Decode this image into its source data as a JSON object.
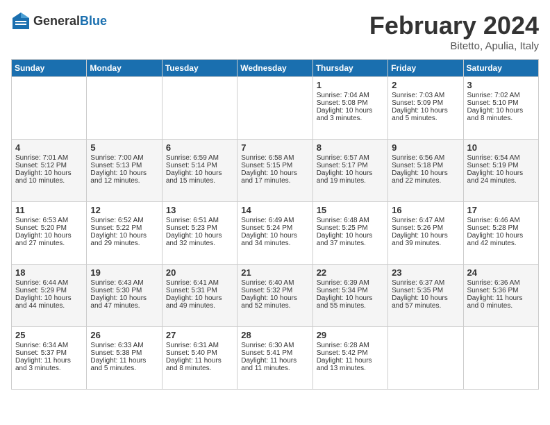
{
  "header": {
    "logo_general": "General",
    "logo_blue": "Blue",
    "title": "February 2024",
    "subtitle": "Bitetto, Apulia, Italy"
  },
  "days_of_week": [
    "Sunday",
    "Monday",
    "Tuesday",
    "Wednesday",
    "Thursday",
    "Friday",
    "Saturday"
  ],
  "weeks": [
    [
      {
        "day": "",
        "sunrise": "",
        "sunset": "",
        "daylight": "",
        "empty": true
      },
      {
        "day": "",
        "sunrise": "",
        "sunset": "",
        "daylight": "",
        "empty": true
      },
      {
        "day": "",
        "sunrise": "",
        "sunset": "",
        "daylight": "",
        "empty": true
      },
      {
        "day": "",
        "sunrise": "",
        "sunset": "",
        "daylight": "",
        "empty": true
      },
      {
        "day": "1",
        "sunrise": "Sunrise: 7:04 AM",
        "sunset": "Sunset: 5:08 PM",
        "daylight": "Daylight: 10 hours and 3 minutes."
      },
      {
        "day": "2",
        "sunrise": "Sunrise: 7:03 AM",
        "sunset": "Sunset: 5:09 PM",
        "daylight": "Daylight: 10 hours and 5 minutes."
      },
      {
        "day": "3",
        "sunrise": "Sunrise: 7:02 AM",
        "sunset": "Sunset: 5:10 PM",
        "daylight": "Daylight: 10 hours and 8 minutes."
      }
    ],
    [
      {
        "day": "4",
        "sunrise": "Sunrise: 7:01 AM",
        "sunset": "Sunset: 5:12 PM",
        "daylight": "Daylight: 10 hours and 10 minutes."
      },
      {
        "day": "5",
        "sunrise": "Sunrise: 7:00 AM",
        "sunset": "Sunset: 5:13 PM",
        "daylight": "Daylight: 10 hours and 12 minutes."
      },
      {
        "day": "6",
        "sunrise": "Sunrise: 6:59 AM",
        "sunset": "Sunset: 5:14 PM",
        "daylight": "Daylight: 10 hours and 15 minutes."
      },
      {
        "day": "7",
        "sunrise": "Sunrise: 6:58 AM",
        "sunset": "Sunset: 5:15 PM",
        "daylight": "Daylight: 10 hours and 17 minutes."
      },
      {
        "day": "8",
        "sunrise": "Sunrise: 6:57 AM",
        "sunset": "Sunset: 5:17 PM",
        "daylight": "Daylight: 10 hours and 19 minutes."
      },
      {
        "day": "9",
        "sunrise": "Sunrise: 6:56 AM",
        "sunset": "Sunset: 5:18 PM",
        "daylight": "Daylight: 10 hours and 22 minutes."
      },
      {
        "day": "10",
        "sunrise": "Sunrise: 6:54 AM",
        "sunset": "Sunset: 5:19 PM",
        "daylight": "Daylight: 10 hours and 24 minutes."
      }
    ],
    [
      {
        "day": "11",
        "sunrise": "Sunrise: 6:53 AM",
        "sunset": "Sunset: 5:20 PM",
        "daylight": "Daylight: 10 hours and 27 minutes."
      },
      {
        "day": "12",
        "sunrise": "Sunrise: 6:52 AM",
        "sunset": "Sunset: 5:22 PM",
        "daylight": "Daylight: 10 hours and 29 minutes."
      },
      {
        "day": "13",
        "sunrise": "Sunrise: 6:51 AM",
        "sunset": "Sunset: 5:23 PM",
        "daylight": "Daylight: 10 hours and 32 minutes."
      },
      {
        "day": "14",
        "sunrise": "Sunrise: 6:49 AM",
        "sunset": "Sunset: 5:24 PM",
        "daylight": "Daylight: 10 hours and 34 minutes."
      },
      {
        "day": "15",
        "sunrise": "Sunrise: 6:48 AM",
        "sunset": "Sunset: 5:25 PM",
        "daylight": "Daylight: 10 hours and 37 minutes."
      },
      {
        "day": "16",
        "sunrise": "Sunrise: 6:47 AM",
        "sunset": "Sunset: 5:26 PM",
        "daylight": "Daylight: 10 hours and 39 minutes."
      },
      {
        "day": "17",
        "sunrise": "Sunrise: 6:46 AM",
        "sunset": "Sunset: 5:28 PM",
        "daylight": "Daylight: 10 hours and 42 minutes."
      }
    ],
    [
      {
        "day": "18",
        "sunrise": "Sunrise: 6:44 AM",
        "sunset": "Sunset: 5:29 PM",
        "daylight": "Daylight: 10 hours and 44 minutes."
      },
      {
        "day": "19",
        "sunrise": "Sunrise: 6:43 AM",
        "sunset": "Sunset: 5:30 PM",
        "daylight": "Daylight: 10 hours and 47 minutes."
      },
      {
        "day": "20",
        "sunrise": "Sunrise: 6:41 AM",
        "sunset": "Sunset: 5:31 PM",
        "daylight": "Daylight: 10 hours and 49 minutes."
      },
      {
        "day": "21",
        "sunrise": "Sunrise: 6:40 AM",
        "sunset": "Sunset: 5:32 PM",
        "daylight": "Daylight: 10 hours and 52 minutes."
      },
      {
        "day": "22",
        "sunrise": "Sunrise: 6:39 AM",
        "sunset": "Sunset: 5:34 PM",
        "daylight": "Daylight: 10 hours and 55 minutes."
      },
      {
        "day": "23",
        "sunrise": "Sunrise: 6:37 AM",
        "sunset": "Sunset: 5:35 PM",
        "daylight": "Daylight: 10 hours and 57 minutes."
      },
      {
        "day": "24",
        "sunrise": "Sunrise: 6:36 AM",
        "sunset": "Sunset: 5:36 PM",
        "daylight": "Daylight: 11 hours and 0 minutes."
      }
    ],
    [
      {
        "day": "25",
        "sunrise": "Sunrise: 6:34 AM",
        "sunset": "Sunset: 5:37 PM",
        "daylight": "Daylight: 11 hours and 3 minutes."
      },
      {
        "day": "26",
        "sunrise": "Sunrise: 6:33 AM",
        "sunset": "Sunset: 5:38 PM",
        "daylight": "Daylight: 11 hours and 5 minutes."
      },
      {
        "day": "27",
        "sunrise": "Sunrise: 6:31 AM",
        "sunset": "Sunset: 5:40 PM",
        "daylight": "Daylight: 11 hours and 8 minutes."
      },
      {
        "day": "28",
        "sunrise": "Sunrise: 6:30 AM",
        "sunset": "Sunset: 5:41 PM",
        "daylight": "Daylight: 11 hours and 11 minutes."
      },
      {
        "day": "29",
        "sunrise": "Sunrise: 6:28 AM",
        "sunset": "Sunset: 5:42 PM",
        "daylight": "Daylight: 11 hours and 13 minutes."
      },
      {
        "day": "",
        "sunrise": "",
        "sunset": "",
        "daylight": "",
        "empty": true
      },
      {
        "day": "",
        "sunrise": "",
        "sunset": "",
        "daylight": "",
        "empty": true
      }
    ]
  ]
}
